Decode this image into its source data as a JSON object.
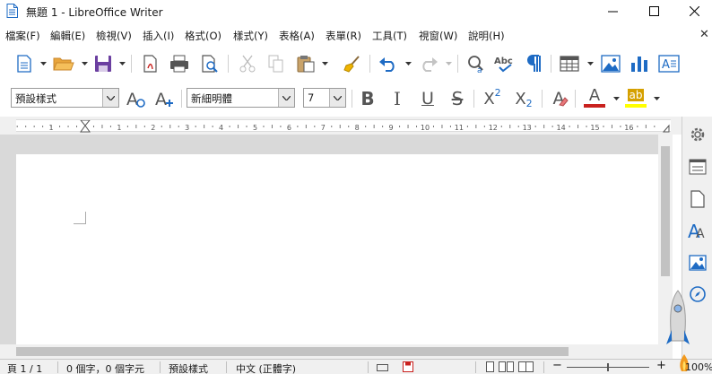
{
  "window": {
    "title": "無題 1 - LibreOffice Writer",
    "minimize_glyph": "—",
    "maximize_glyph": "☐",
    "close_glyph": "✕"
  },
  "menu": {
    "items": [
      "檔案(F)",
      "編輯(E)",
      "檢視(V)",
      "插入(I)",
      "格式(O)",
      "樣式(Y)",
      "表格(A)",
      "表單(R)",
      "工具(T)",
      "視窗(W)",
      "說明(H)"
    ],
    "close_doc": "✕"
  },
  "toolbar_standard": {
    "icons": [
      "new-document-icon",
      "open-folder-icon",
      "save-icon",
      "export-pdf-icon",
      "print-icon",
      "print-preview-icon",
      "cut-icon",
      "copy-icon",
      "paste-icon",
      "clone-formatting-icon",
      "undo-icon",
      "redo-icon",
      "find-replace-icon",
      "spelling-icon",
      "formatting-marks-icon",
      "insert-table-icon",
      "insert-image-icon",
      "insert-chart-icon",
      "insert-textbox-icon"
    ]
  },
  "toolbar_formatting": {
    "paragraph_style": "預設樣式",
    "font_name": "新細明體",
    "font_size": "7",
    "bold_glyph": "B",
    "italic_glyph": "I",
    "underline_glyph": "U",
    "strike_glyph": "S",
    "superscript_base": "X",
    "superscript_exp": "2",
    "subscript_base": "X",
    "subscript_exp": "2",
    "font_color_glyph": "A",
    "highlight_glyph": "ab",
    "clear_format_glyph": "A",
    "colors": {
      "font_color": "#c9211e",
      "highlight": "#ffff00"
    }
  },
  "ruler": {
    "numbers": [
      "1",
      "1",
      "2",
      "3",
      "4",
      "5",
      "6",
      "7",
      "8",
      "9",
      "10",
      "11",
      "12",
      "13",
      "14",
      "15",
      "16"
    ]
  },
  "sidebar": {
    "icons": [
      "properties-gear-icon",
      "page-icon",
      "styles-icon",
      "gallery-icon",
      "navigator-icon"
    ]
  },
  "status": {
    "page": "頁 1 / 1",
    "words": "0 個字，0 個字元",
    "page_style": "預設樣式",
    "language": "中文 (正體字)",
    "zoom": "100%"
  },
  "theme": {
    "accent": "#1e6bc4",
    "save_purple": "#6b3fa0",
    "toolbar_icon": "#555555"
  }
}
